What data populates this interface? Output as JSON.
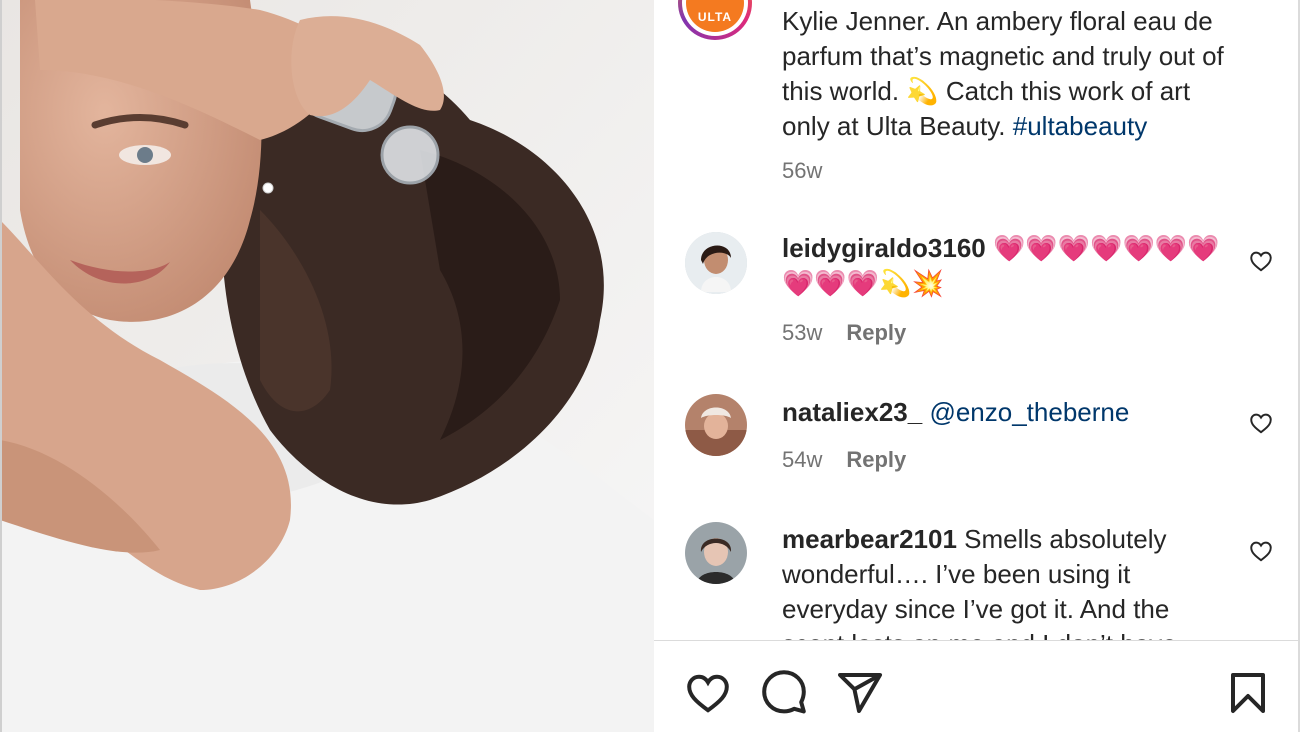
{
  "post": {
    "brand_logo_text": "ULTA",
    "caption_lines": [
      "Kylie Jenner. An ambery floral eau de",
      "parfum that’s magnetic and truly out of",
      "this world. 💫 Catch this work of art",
      "only at Ulta Beauty."
    ],
    "hashtag": "#ultabeauty",
    "age": "56w"
  },
  "comments": [
    {
      "username": "leidygiraldo3160",
      "line1": "💗💗💗💗💗💗💗",
      "line2": "💗💗💗💫💥",
      "age": "53w",
      "reply": "Reply"
    },
    {
      "username": "nataliex23_",
      "mention": "@enzo_theberne",
      "age": "54w",
      "reply": "Reply"
    },
    {
      "username": "mearbear2101",
      "line1": "Smells absolutely",
      "line2": "wonderful…. I’ve been using it",
      "line3": "everyday since I’ve got it. And the",
      "line4": "scent lasts on me and I don’t have"
    }
  ],
  "icons": [
    "heart-icon",
    "comment-icon",
    "share-icon",
    "bookmark-icon",
    "comment-like-icon"
  ],
  "colors": {
    "link": "#00376b",
    "meta": "#737373",
    "text": "#262626",
    "ulta_orange": "#f47a20"
  }
}
